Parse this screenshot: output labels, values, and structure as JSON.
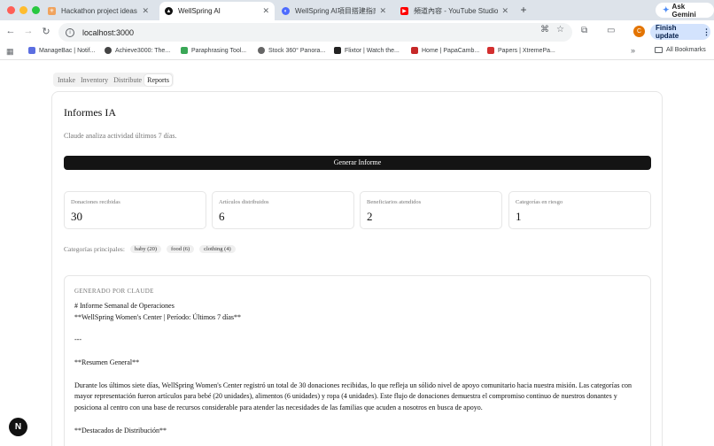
{
  "browser": {
    "tabs": [
      {
        "title": "Hackathon project ideas for a",
        "active": false,
        "favicon_color": "#f0a35e"
      },
      {
        "title": "WellSpring AI",
        "active": true,
        "favicon_color": "#111111"
      },
      {
        "title": "WellSpring AI項目搭建指南迅",
        "active": false,
        "favicon_color": "#4d6bfe"
      },
      {
        "title": "頻道內容 - YouTube Studio",
        "active": false,
        "favicon_color": "#ff0000"
      }
    ],
    "ask_gemini": "Ask Gemini",
    "url": "localhost:3000",
    "profile_initial": "C",
    "finish_update": "Finish update",
    "bookmarks": [
      {
        "label": "ManageBac | Notif...",
        "favicon_color": "#5b6ee1"
      },
      {
        "label": "Achieve3000: The...",
        "favicon_color": "#444444"
      },
      {
        "label": "Paraphrasing Tool...",
        "favicon_color": "#3aa757"
      },
      {
        "label": "Stock 360° Panora...",
        "favicon_color": "#666666"
      },
      {
        "label": "Flixtor | Watch the...",
        "favicon_color": "#222222"
      },
      {
        "label": "Home | PapaCamb...",
        "favicon_color": "#c62828"
      },
      {
        "label": "Papers | XtremePa...",
        "favicon_color": "#d32f2f"
      }
    ],
    "all_bookmarks": "All Bookmarks"
  },
  "nav_tabs": [
    {
      "label": "Intake",
      "active": false
    },
    {
      "label": "Inventory",
      "active": false
    },
    {
      "label": "Distribute",
      "active": false
    },
    {
      "label": "Reports",
      "active": true
    }
  ],
  "report_card": {
    "title": "Informes IA",
    "subtitle": "Claude analiza actividad últimos 7 días.",
    "generate_button": "Generar Informe",
    "stats": [
      {
        "label": "Donaciones recibidas",
        "value": "30"
      },
      {
        "label": "Artículos distribuidos",
        "value": "6"
      },
      {
        "label": "Beneficiarios atendidos",
        "value": "2"
      },
      {
        "label": "Categorías en riesgo",
        "value": "1"
      }
    ],
    "categories_label": "Categorías principales:",
    "categories": [
      "baby (20)",
      "food (6)",
      "clothing (4)"
    ],
    "generated_by": "GENERADO POR CLAUDE",
    "report_lines": [
      "# Informe Semanal de Operaciones",
      "**WellSpring Women's Center | Período: Últimos 7 días**",
      "",
      "---",
      "",
      "**Resumen General**",
      "",
      "Durante los últimos siete días, WellSpring Women's Center registró un total de 30 donaciones recibidas, lo que refleja un sólido nivel de apoyo comunitario hacia nuestra misión. Las categorías con mayor representación fueron artículos para bebé (20 unidades), alimentos (6 unidades) y ropa (4 unidades). Este flujo de donaciones demuestra el compromiso continuo de nuestros donantes y posiciona al centro con una base de recursos considerable para atender las necesidades de las familias que acuden a nosotros en busca de apoyo.",
      "",
      "**Destacados de Distribución**"
    ]
  },
  "next_badge": "N"
}
